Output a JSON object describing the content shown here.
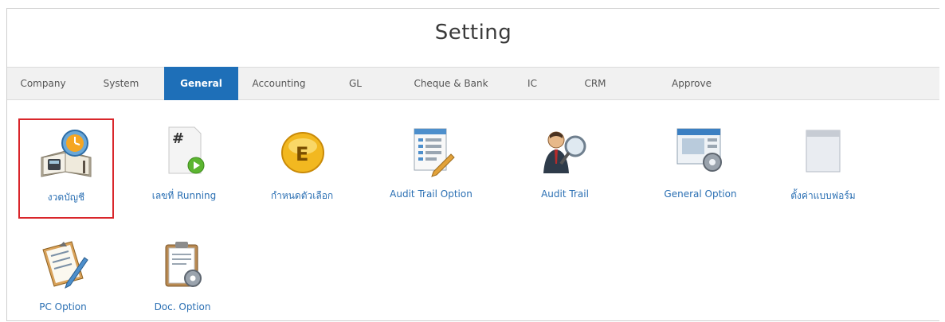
{
  "header": {
    "title": "Setting"
  },
  "tabs": [
    {
      "label": "Company"
    },
    {
      "label": "System"
    },
    {
      "label": "General"
    },
    {
      "label": "Accounting"
    },
    {
      "label": "GL"
    },
    {
      "label": "Cheque & Bank"
    },
    {
      "label": "IC"
    },
    {
      "label": "CRM"
    },
    {
      "label": "Approve"
    }
  ],
  "active_tab": "General",
  "items": [
    {
      "label": "งวดบัญชี",
      "icon": "calendar-book-icon"
    },
    {
      "label": "เลขที่ Running",
      "icon": "running-number-icon"
    },
    {
      "label": "กำหนดตัวเลือก",
      "icon": "e-option-icon"
    },
    {
      "label": "Audit Trail Option",
      "icon": "audit-trail-option-icon"
    },
    {
      "label": "Audit Trail",
      "icon": "audit-trail-icon"
    },
    {
      "label": "General Option",
      "icon": "general-option-icon"
    },
    {
      "label": "ตั้งค่าแบบฟอร์ม",
      "icon": "form-setting-icon"
    },
    {
      "label": "PC Option",
      "icon": "pc-option-icon"
    },
    {
      "label": "Doc. Option",
      "icon": "doc-option-icon"
    }
  ],
  "selected_item": "งวดบัญชี",
  "colors": {
    "active_tab": "#1e6fb8",
    "link_text": "#2a6fb3",
    "selection_border": "#d9262b"
  }
}
